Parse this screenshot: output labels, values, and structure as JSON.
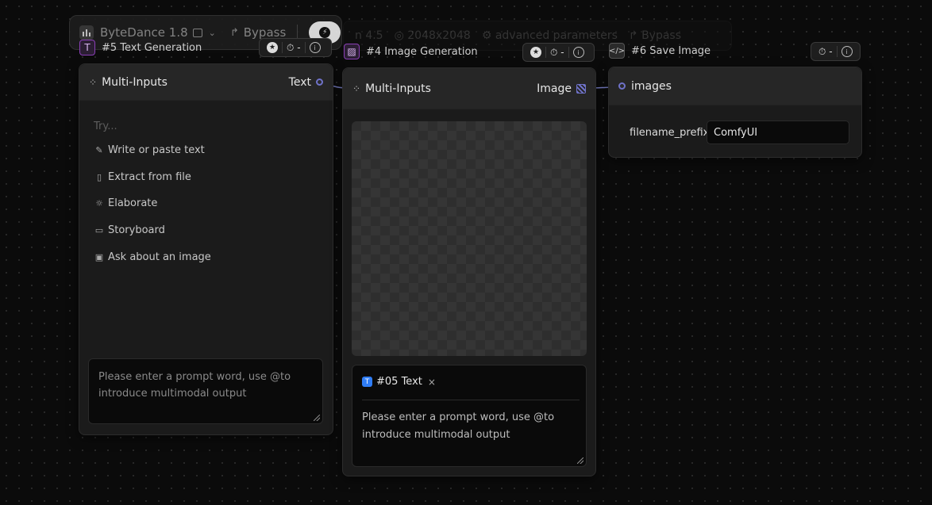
{
  "toolbar": {
    "model_name": "ByteDance 1.8",
    "bypass_label": "Bypass"
  },
  "ghost_bar": {
    "model_suffix": "n 4.5",
    "resolution": "2048x2048",
    "advanced": "advanced parameters",
    "bypass": "Bypass"
  },
  "node_text": {
    "title": "#5 Text Generation",
    "inputs_label": "Multi-Inputs",
    "output_label": "Text",
    "try_label": "Try...",
    "menu": [
      "Write or paste text",
      "Extract from file",
      "Elaborate",
      "Storyboard",
      "Ask about an image"
    ],
    "prompt_placeholder": "Please enter a prompt word, use @to introduce multimodal output",
    "timer_value": "-"
  },
  "node_image": {
    "title": "#4 Image Generation",
    "inputs_label": "Multi-Inputs",
    "output_label": "Image",
    "chip_label": "#05 Text",
    "chip_close": "×",
    "prompt_placeholder": "Please enter a prompt word, use @to introduce multimodal output",
    "timer_value": "-"
  },
  "node_save": {
    "title": "#6 Save Image",
    "input_label": "images",
    "field_label": "filename_prefix",
    "field_value": "ComfyUI",
    "timer_value": "-"
  },
  "colors": {
    "port_border": "#6f72c9",
    "title_icon_text": "#8b3fb7",
    "chip_blue": "#2f7df6",
    "link": "#7a80c8"
  }
}
